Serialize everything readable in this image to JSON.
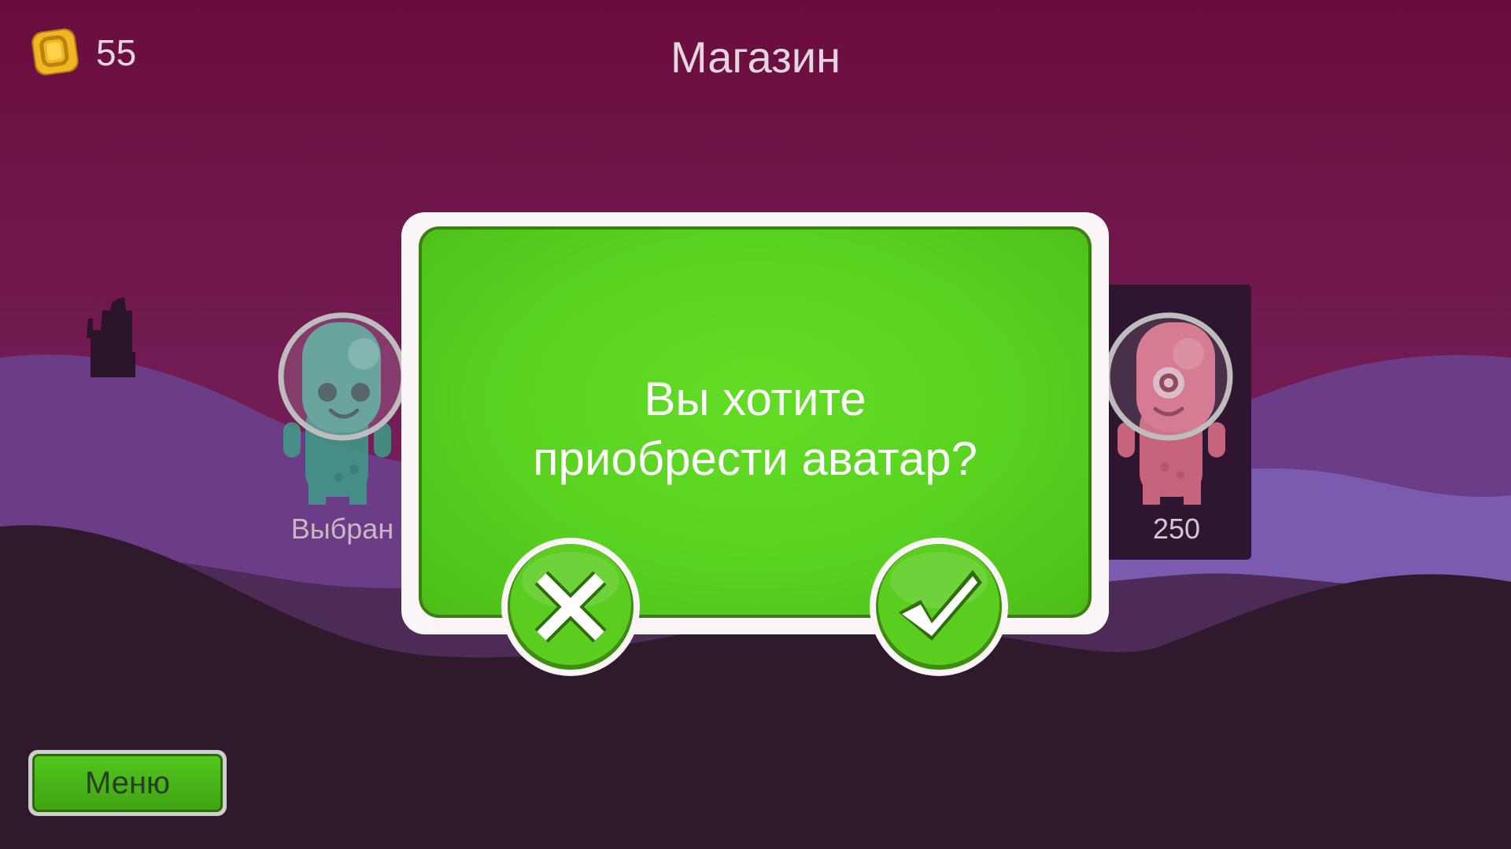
{
  "header": {
    "coins": "55",
    "coin_icon": "gold-coin-icon",
    "title": "Магазин"
  },
  "avatars": [
    {
      "name": "green-alien",
      "label": "Выбран",
      "color": "#4bb39a"
    },
    {
      "name": "pink-cyclops-alien",
      "label": "250",
      "color": "#e8788f"
    }
  ],
  "dialog": {
    "message_line1": "Вы хотите",
    "message_line2": "приобрести аватар?",
    "cancel_icon": "close-icon",
    "confirm_icon": "checkmark-icon",
    "panel_color": "#5bd420"
  },
  "menu": {
    "label": "Меню"
  },
  "colors": {
    "sky_top": "#6b0f3f",
    "sky_bottom": "#7b2a63",
    "hill_far": "#6a3f88",
    "ground": "#2e1b2b"
  }
}
